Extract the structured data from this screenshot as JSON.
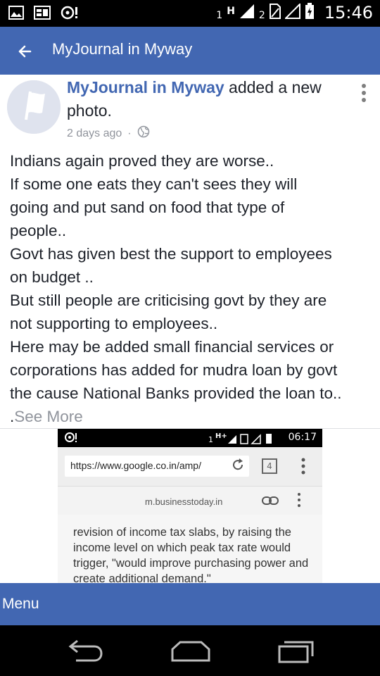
{
  "status_bar": {
    "time": "15:46",
    "sim1": "1",
    "network": "H",
    "sim2": "2"
  },
  "app_bar": {
    "title": "MyJournal in Myway"
  },
  "post": {
    "page_name": "MyJournal in Myway",
    "action": " added a new photo.",
    "timestamp": "2 days ago",
    "privacy_separator": "·",
    "lines": [
      "Indians again proved they are worse..",
      "If some one eats they can't sees they will",
      "going and put sand on food that type of",
      "people..",
      "Govt has given best the support to employees",
      "on budget ..",
      "But still people are criticising govt by they are",
      "not supporting to employees..",
      "Here may be added small financial services or",
      "corporations has added for mudra loan by govt",
      "the cause National Banks provided the loan to.."
    ],
    "last_prefix": ".",
    "see_more": "See More"
  },
  "photo": {
    "time": "06:17",
    "url": "https://www.google.co.in/amp/",
    "tab_count": "4",
    "domain": "m.businesstoday.in",
    "body": "revision of income tax slabs, by raising the income level on which peak tax rate would trigger, \"would improve purchasing power and create additional demand.\""
  },
  "menu": {
    "label": "Menu"
  },
  "colors": {
    "brand": "#4267b2",
    "link": "#4267b2",
    "muted": "#90949c"
  }
}
